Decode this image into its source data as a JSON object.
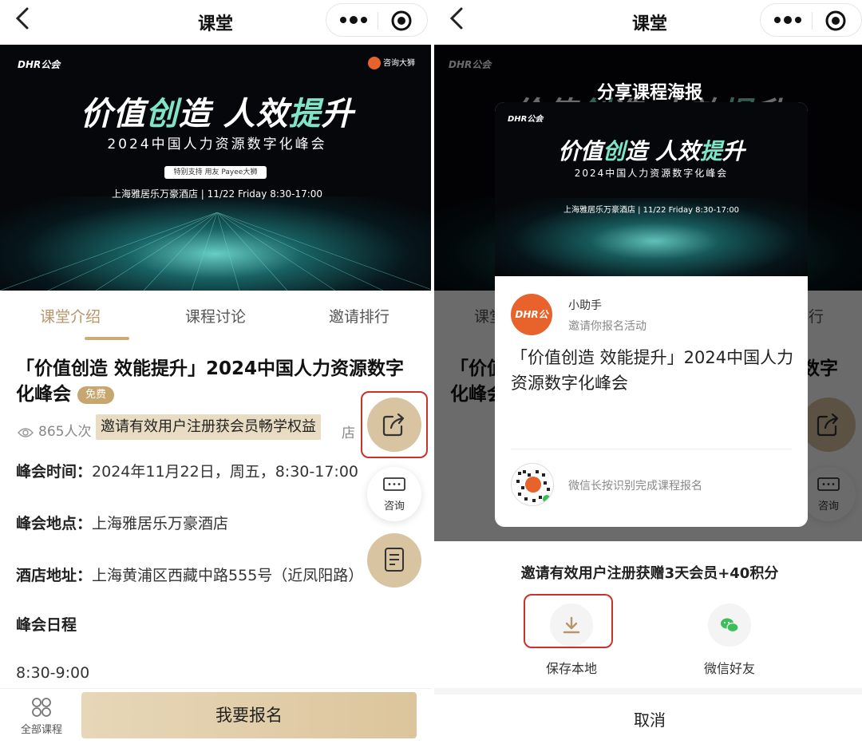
{
  "nav": {
    "title": "课堂",
    "back_icon": "chevron-left-icon",
    "more_icon": "more-dots-icon",
    "close_icon": "target-icon"
  },
  "banner": {
    "brand": "DHR公会",
    "partner": "咨询大狮",
    "headline_a": "价值",
    "headline_b": "创",
    "headline_c": "造 人效",
    "headline_d": "提",
    "headline_e": "升",
    "subtitle": "2024中国人力资源数字化峰会",
    "sponsor": "特别支持 用友 Payee大狮",
    "venue": "上海雅居乐万豪酒店 | 11/22 Friday 8:30-17:00"
  },
  "tabs": [
    {
      "label": "课堂介绍",
      "active": true
    },
    {
      "label": "课程讨论",
      "active": false
    },
    {
      "label": "邀请排行",
      "active": false
    }
  ],
  "course": {
    "title": "「价值创造 效能提升」2024中国人力资源数字化峰会",
    "badge": "免费",
    "views": "865人次",
    "highlight": "邀请有效用户注册获会员畅学权益",
    "views_tail": "店",
    "time_label": "峰会时间：",
    "time_value": "2024年11月22日，周五，8:30-17:00",
    "place_label": "峰会地点：",
    "place_value": "上海雅居乐万豪酒店",
    "address_label": "酒店地址：",
    "address_value": "上海黄浦区西藏中路555号（近凤阳路）",
    "schedule_label": "峰会日程",
    "schedule_first": "8:30-9:00"
  },
  "fab": {
    "consult_label": "咨询"
  },
  "bottom": {
    "all_courses": "全部课程",
    "signup": "我要报名"
  },
  "share": {
    "title": "分享课程海报",
    "poster_name": "小助手",
    "poster_invite": "邀请你报名活动",
    "poster_title": "「价值创造 效能提升」2024中国人力资源数字化峰会",
    "scan_text": "微信长按识别完成课程报名",
    "avatar_text": "DHR公会",
    "tip": "邀请有效用户注册获赠3天会员+40积分",
    "save_label": "保存本地",
    "wechat_label": "微信好友",
    "cancel": "取消"
  },
  "colors": {
    "accent": "#c9ac78",
    "highlight_red": "#c8322d",
    "gold_fab": "#d9c4a2"
  }
}
